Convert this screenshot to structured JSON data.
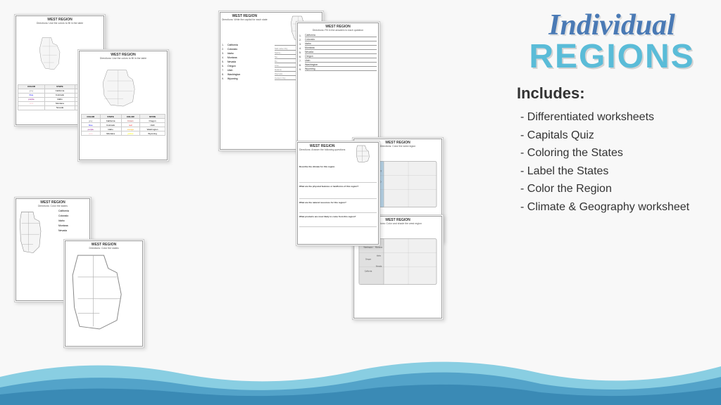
{
  "title": {
    "line1": "Individual",
    "line2": "REGIONS"
  },
  "includes": {
    "heading": "Includes:",
    "items": [
      "Differentiated worksheets",
      "Capitals Quiz",
      "Coloring the States",
      "Label the States",
      "Color the Region",
      "Climate & Geography worksheet"
    ]
  },
  "worksheets": [
    {
      "id": "ws-coloring-table",
      "title": "WEST REGION",
      "subtitle": "Directions: Use the colors to fill in the table",
      "type": "color-table"
    },
    {
      "id": "ws-coloring-table-2",
      "title": "WEST REGION",
      "subtitle": "Directions: Use the colors to fill in the table",
      "type": "color-table-map"
    },
    {
      "id": "ws-capitals",
      "title": "WEST REGION",
      "subtitle": "Directions: Write the capital for each state",
      "type": "capitals-list",
      "states": [
        "California",
        "Colorado",
        "Idaho",
        "Montana",
        "Nevada",
        "Oregon",
        "Utah",
        "Washington",
        "Wyoming"
      ],
      "capitals": [
        "Sacramento",
        "Denver",
        "Boise",
        "Helena",
        "Carson City",
        "Salem",
        "Salt Lake City",
        "Olympia",
        "Cheyenne"
      ]
    },
    {
      "id": "ws-states-list",
      "title": "WEST REGION",
      "subtitle": "Directions: Fill in the answers to each question",
      "type": "states-list"
    },
    {
      "id": "ws-label-map",
      "title": "WEST REGION",
      "subtitle": "Directions: Color the west region",
      "type": "us-map-color"
    },
    {
      "id": "ws-label-us",
      "title": "WEST REGION",
      "subtitle": "Directions: Color and shade the west region",
      "type": "us-map-label"
    },
    {
      "id": "ws-west-blank",
      "title": "WEST REGION",
      "subtitle": "Directions: Color the states",
      "type": "west-blank"
    },
    {
      "id": "ws-west-outline",
      "title": "WEST REGION",
      "subtitle": "Directions: Color the states",
      "type": "west-outline"
    },
    {
      "id": "ws-climate",
      "title": "WEST REGION",
      "subtitle": "Directions: Answer the following questions",
      "type": "climate",
      "questions": [
        "Describe the climate for this region.",
        "What are the physical features or landforms of this region?",
        "What are the natural resources for this region?",
        "What products are most likely to come from this region?"
      ]
    }
  ],
  "colors": {
    "background": "#f8f8f8",
    "wave": "#4a9bc4",
    "wave2": "#6bc4de",
    "titleBlue": "#4a7ab5",
    "titleTeal": "#5abcd8"
  }
}
